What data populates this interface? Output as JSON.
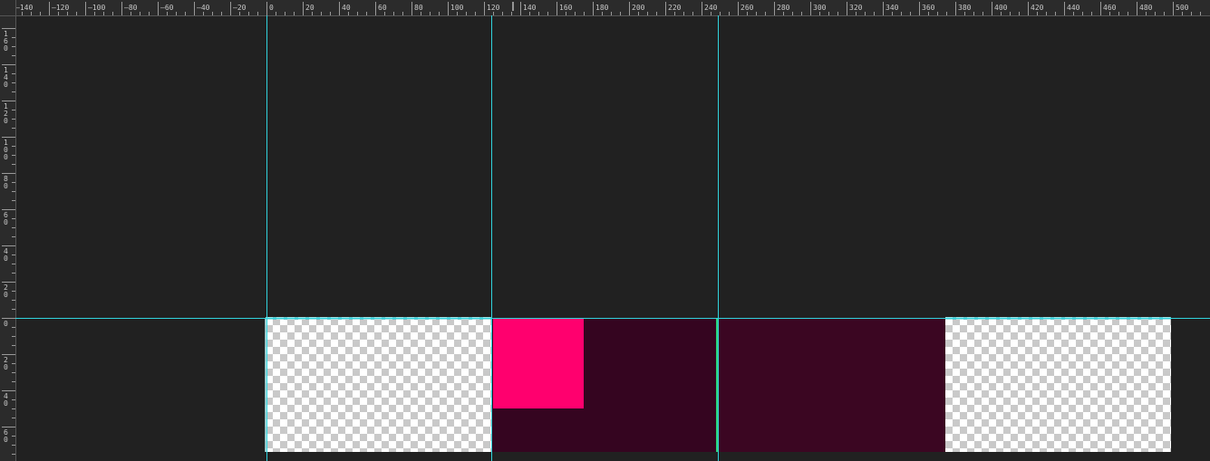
{
  "rulers": {
    "top_labels": [
      "-140",
      "-120",
      "-100",
      "-80",
      "-60",
      "-40",
      "-20",
      "0",
      "20",
      "40",
      "60",
      "80",
      "100",
      "120",
      "140",
      "160",
      "180",
      "200",
      "220",
      "240",
      "260",
      "280",
      "300",
      "320",
      "340",
      "360",
      "380",
      "400",
      "420",
      "440",
      "460",
      "480",
      "500"
    ],
    "left_labels": [
      "160",
      "140",
      "120",
      "100",
      "80",
      "60",
      "40",
      "20",
      "0",
      "20",
      "40",
      "60"
    ]
  },
  "colors": {
    "canvas_bg": "#212121",
    "guide": "#31d3dd",
    "artboard_dark": "#3b0622",
    "artboard_dark_2": "#350520",
    "pink_shape": "#ff006e",
    "green_divider": "#2bd37b"
  }
}
